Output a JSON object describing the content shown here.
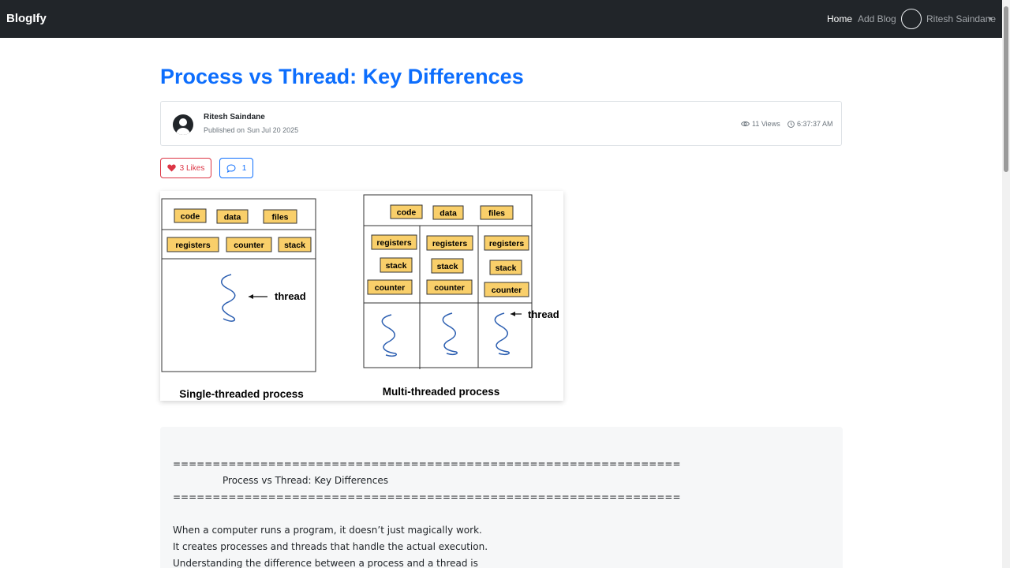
{
  "navbar": {
    "brand": "BlogIfy",
    "links": {
      "home": "Home",
      "add_blog": "Add Blog"
    },
    "user_name": "Ritesh Saindane"
  },
  "post": {
    "title": "Process vs Thread: Key Differences",
    "author": "Ritesh Saindane",
    "published_label": "Published on",
    "published_date": "Sun Jul 20 2025",
    "views": "11 Views",
    "time": "6:37:37 AM",
    "likes": "3 Likes",
    "comments": "1"
  },
  "diagram": {
    "single": {
      "caption": "Single-threaded process",
      "shared": [
        "code",
        "data",
        "files"
      ],
      "per_thread": [
        "registers",
        "counter",
        "stack"
      ],
      "thread_label": "thread"
    },
    "multi": {
      "caption": "Multi-threaded process",
      "shared": [
        "code",
        "data",
        "files"
      ],
      "registers": "registers",
      "stack": "stack",
      "counter": "counter",
      "thread_label": "thread"
    },
    "box_color": "#f9cf6a"
  },
  "content": {
    "rule": "================================================================",
    "heading": "Process vs Thread: Key Differences",
    "paragraph": [
      "When a computer runs a program, it doesn’t just magically work.",
      "It creates processes and threads that handle the actual execution.",
      "Understanding the difference between a process and a thread is"
    ]
  },
  "colors": {
    "accent": "#0d6efd",
    "like": "#dc3545",
    "navbar": "#212529"
  }
}
